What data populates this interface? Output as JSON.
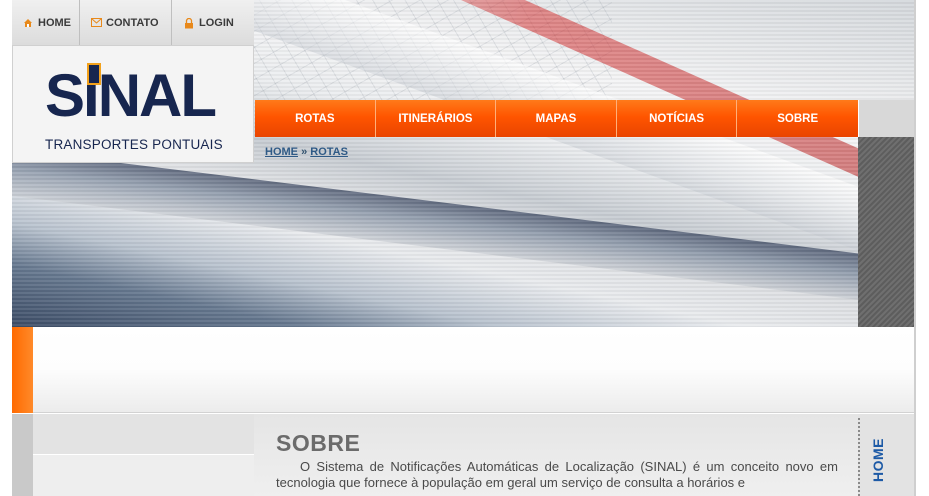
{
  "toplinks": [
    {
      "label": "HOME",
      "icon": "home-icon"
    },
    {
      "label": "CONTATO",
      "icon": "envelope-icon"
    },
    {
      "label": "LOGIN",
      "icon": "lock-icon"
    }
  ],
  "logo": {
    "word": "SINAL",
    "subtitle": "TRANSPORTES PONTUAIS"
  },
  "nav": [
    "ROTAS",
    "ITINERÁRIOS",
    "MAPAS",
    "NOTÍCIAS",
    "SOBRE"
  ],
  "breadcrumb": {
    "home": "HOME",
    "separator": "»",
    "current": "ROTAS"
  },
  "content": {
    "title": "SOBRE",
    "text": "O Sistema de Notificações Automáticas de Localização (SINAL) é um conceito novo em tecnologia que fornece à população em geral um serviço de consulta a horários e"
  },
  "side_label": "HOME",
  "colors": {
    "accent": "#ff5500",
    "brand": "#17264f",
    "link": "#2f5a86"
  }
}
